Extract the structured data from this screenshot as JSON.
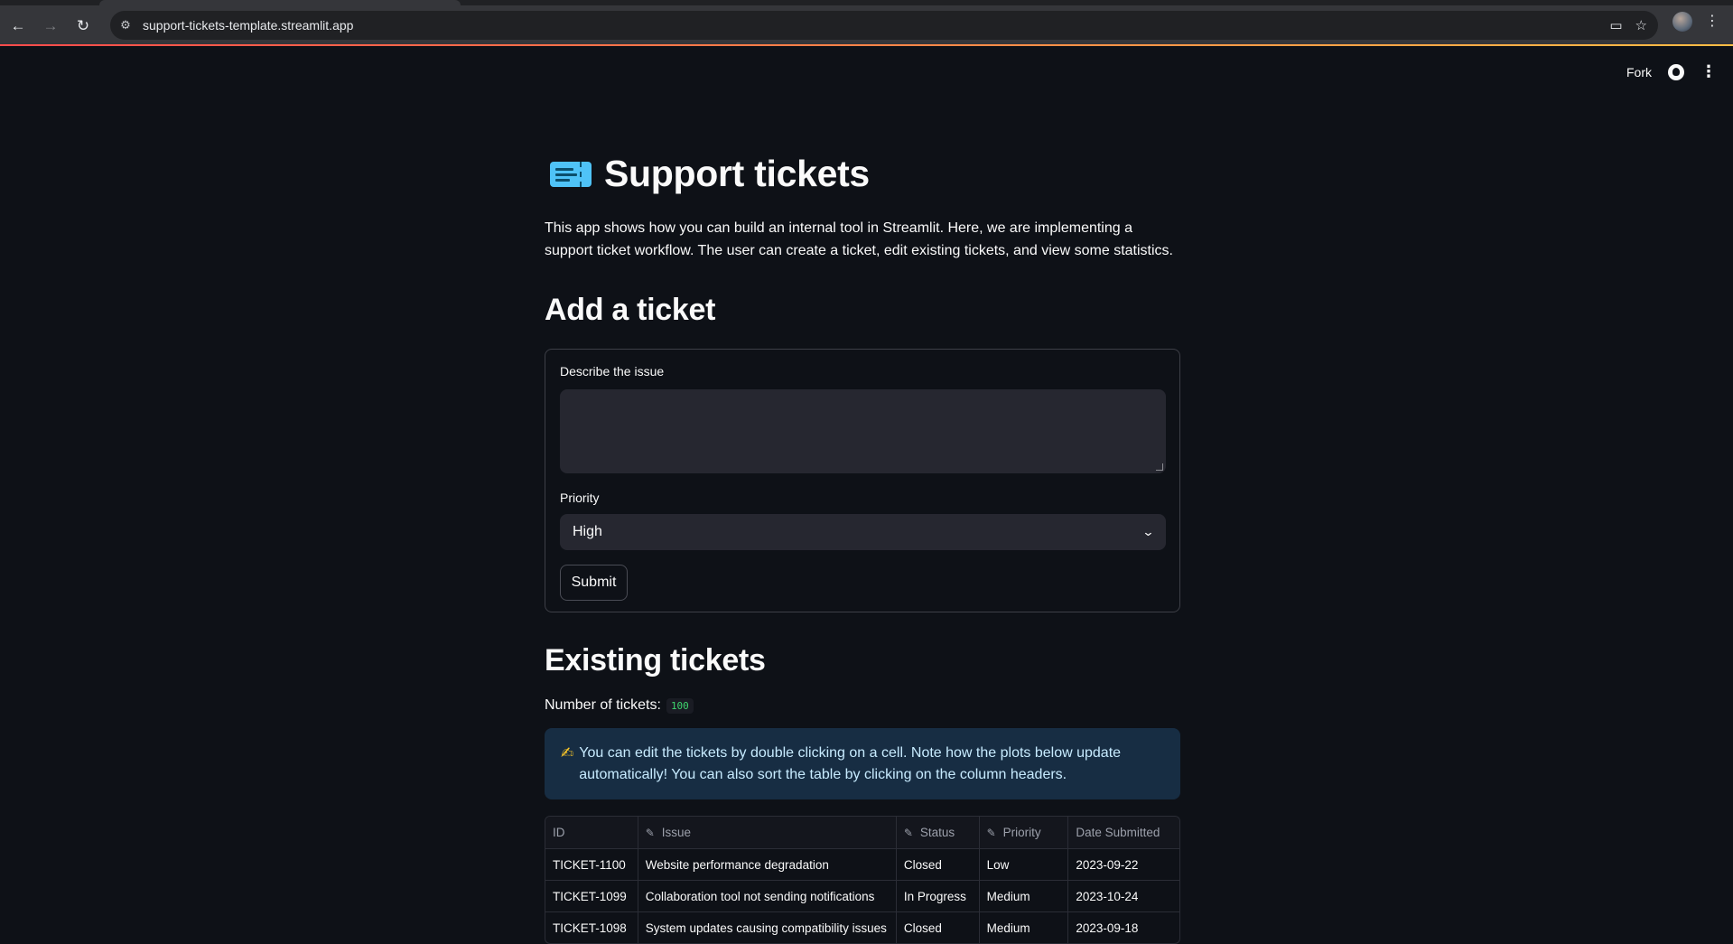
{
  "browser": {
    "url": "support-tickets-template.streamlit.app"
  },
  "header": {
    "fork_label": "Fork"
  },
  "page": {
    "title": "Support tickets",
    "intro": "This app shows how you can build an internal tool in Streamlit. Here, we are implementing a support ticket workflow. The user can create a ticket, edit existing tickets, and view some statistics."
  },
  "add_ticket": {
    "heading": "Add a ticket",
    "issue_label": "Describe the issue",
    "issue_value": "",
    "priority_label": "Priority",
    "priority_value": "High",
    "submit_label": "Submit"
  },
  "existing": {
    "heading": "Existing tickets",
    "count_label": "Number of tickets:",
    "count_value": "100",
    "info_text": "You can edit the tickets by double clicking on a cell. Note how the plots below update automatically! You can also sort the table by clicking on the column headers.",
    "columns": [
      "ID",
      "Issue",
      "Status",
      "Priority",
      "Date Submitted"
    ],
    "rows": [
      [
        "TICKET-1100",
        "Website performance degradation",
        "Closed",
        "Low",
        "2023-09-22"
      ],
      [
        "TICKET-1099",
        "Collaboration tool not sending notifications",
        "In Progress",
        "Medium",
        "2023-10-24"
      ],
      [
        "TICKET-1098",
        "System updates causing compatibility issues",
        "Closed",
        "Medium",
        "2023-09-18"
      ]
    ]
  },
  "colors": {
    "background": "#0e1117",
    "input_bg": "#262730",
    "info_bg": "#172d43",
    "code_green": "#3dd56d"
  }
}
